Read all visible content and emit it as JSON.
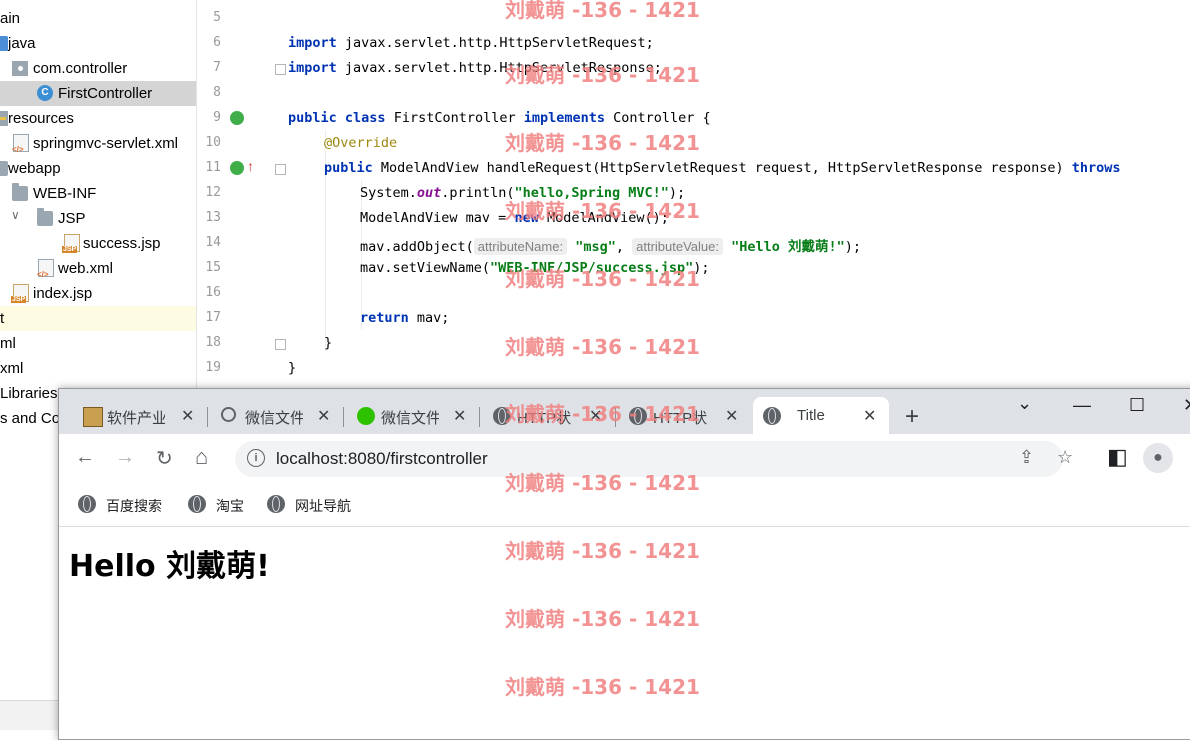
{
  "tree": {
    "items": [
      {
        "label": "ain"
      },
      {
        "label": "java"
      },
      {
        "label": "com.controller"
      },
      {
        "label": "FirstController"
      },
      {
        "label": "resources"
      },
      {
        "label": "springmvc-servlet.xml"
      },
      {
        "label": "webapp"
      },
      {
        "label": "WEB-INF"
      },
      {
        "label": "JSP"
      },
      {
        "label": "success.jsp"
      },
      {
        "label": "web.xml"
      },
      {
        "label": "index.jsp"
      },
      {
        "label": "t"
      },
      {
        "label": "ml"
      },
      {
        "label": "xml"
      },
      {
        "label": "Libraries"
      },
      {
        "label": "s and Co"
      }
    ]
  },
  "editor": {
    "line_numbers": [
      "5",
      "6",
      "7",
      "8",
      "9",
      "10",
      "11",
      "12",
      "13",
      "14",
      "15",
      "16",
      "17",
      "18",
      "19"
    ],
    "code": {
      "l6_kw": "import",
      "l6_rest": " javax.servlet.http.HttpServletRequest;",
      "l7_kw": "import",
      "l7_rest": " javax.servlet.http.HttpServletResponse;",
      "l9_kw1": "public",
      "l9_kw2": "class",
      "l9_name": " FirstController ",
      "l9_kw3": "implements",
      "l9_rest": " Controller {",
      "l10_ann": "@Override",
      "l11_kw": "public",
      "l11_rest": " ModelAndView handleRequest(HttpServletRequest request, HttpServletResponse response) ",
      "l11_kw2": "throws",
      "l12_a": "System.",
      "l12_static": "out",
      "l12_b": ".println(",
      "l12_str": "\"hello,Spring MVC!\"",
      "l12_c": ");",
      "l13_a": "ModelAndView mav = ",
      "l13_kw": "new",
      "l13_b": " ModelAndView();",
      "l14_a": "mav.addObject(",
      "l14_hint1": "attributeName:",
      "l14_str1": "\"msg\"",
      "l14_comma": ", ",
      "l14_hint2": "attributeValue:",
      "l14_str2": "\"Hello 刘戴萌!\"",
      "l14_c": ");",
      "l15_a": "mav.setViewName(",
      "l15_str": "\"WEB-INF/JSP/success.jsp\"",
      "l15_c": ");",
      "l17_kw": "return",
      "l17_rest": " mav;",
      "l18": "}",
      "l19": "}"
    }
  },
  "watermark": {
    "text": "刘戴萌 -136 - 1421"
  },
  "browser": {
    "tabs": [
      {
        "title": "软件产业"
      },
      {
        "title": "微信文件"
      },
      {
        "title": "微信文件"
      },
      {
        "title": "HTTP状"
      },
      {
        "title": "HTTP状"
      },
      {
        "title": "Title"
      }
    ],
    "new_tab": "+",
    "close_glyph": "✕",
    "window_controls": {
      "dropdown": "⌄",
      "minimize": "—",
      "maximize": "☐",
      "close": "✕"
    },
    "nav": {
      "back": "←",
      "forward": "→",
      "reload": "↻",
      "home": "⌂"
    },
    "address": {
      "url": "localhost:8080/firstcontroller",
      "info": "i",
      "share": "⇪",
      "star": "☆"
    },
    "toolbar_right": {
      "sidepanel": "◧",
      "profile": "●"
    },
    "bookmarks": [
      {
        "label": "百度搜索"
      },
      {
        "label": "淘宝"
      },
      {
        "label": "网址导航"
      }
    ],
    "page": {
      "heading": "Hello 刘戴萌!"
    }
  },
  "colors": {
    "keyword": "#0033b3",
    "string": "#067d17",
    "annotation": "#9e880d",
    "watermark": "#f08080",
    "selected_row": "#d4d4d4"
  },
  "icons": [
    "folder-icon",
    "package-icon",
    "class-icon",
    "xml-file-icon",
    "jsp-file-icon",
    "globe-icon",
    "search-icon",
    "wechat-icon",
    "run-gutter-icon"
  ]
}
